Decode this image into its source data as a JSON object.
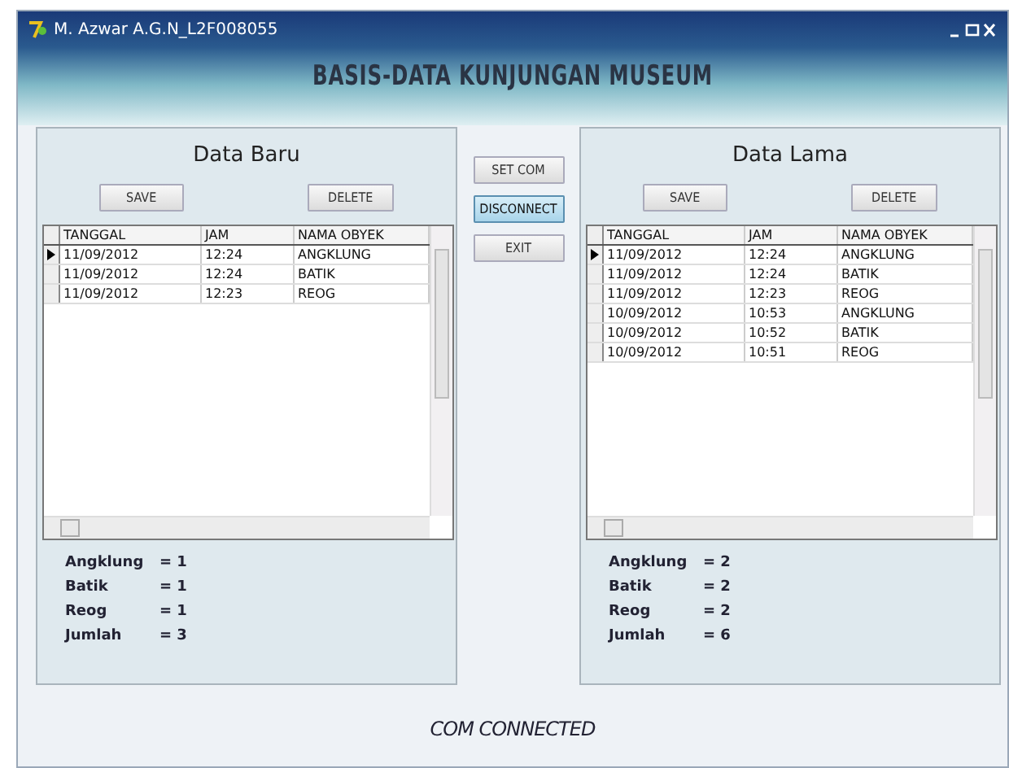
{
  "window": {
    "title": "M. Azwar A.G.N_L2F008055"
  },
  "heading": "BASIS-DATA KUNJUNGAN MUSEUM",
  "panels": [
    {
      "title": "Data Baru",
      "buttons": [
        "SAVE",
        "DELETE"
      ],
      "columns": [
        "TANGGAL",
        "JAM",
        "NAMA OBYEK"
      ],
      "rows": [
        {
          "cells": [
            "11/09/2012",
            "12:24",
            "ANGKLUNG"
          ],
          "selected": true
        },
        {
          "cells": [
            "11/09/2012",
            "12:24",
            "BATIK"
          ],
          "selected": false
        },
        {
          "cells": [
            "11/09/2012",
            "12:23",
            "REOG"
          ],
          "selected": false
        }
      ],
      "stats": [
        {
          "label": "Angklung",
          "value": "= 1"
        },
        {
          "label": "Batik",
          "value": "= 1"
        },
        {
          "label": "Reog",
          "value": "= 1"
        },
        {
          "label": "Jumlah",
          "value": "= 3"
        }
      ]
    },
    {
      "title": "Data Lama",
      "buttons": [
        "SAVE",
        "DELETE"
      ],
      "columns": [
        "TANGGAL",
        "JAM",
        "NAMA OBYEK"
      ],
      "rows": [
        {
          "cells": [
            "11/09/2012",
            "12:24",
            "ANGKLUNG"
          ],
          "selected": true
        },
        {
          "cells": [
            "11/09/2012",
            "12:24",
            "BATIK"
          ],
          "selected": false
        },
        {
          "cells": [
            "11/09/2012",
            "12:23",
            "REOG"
          ],
          "selected": false
        },
        {
          "cells": [
            "10/09/2012",
            "10:53",
            "ANGKLUNG"
          ],
          "selected": false
        },
        {
          "cells": [
            "10/09/2012",
            "10:52",
            "BATIK"
          ],
          "selected": false
        },
        {
          "cells": [
            "10/09/2012",
            "10:51",
            "REOG"
          ],
          "selected": false
        }
      ],
      "stats": [
        {
          "label": "Angklung",
          "value": "= 2"
        },
        {
          "label": "Batik",
          "value": "= 2"
        },
        {
          "label": "Reog",
          "value": "= 2"
        },
        {
          "label": "Jumlah",
          "value": "= 6"
        }
      ]
    }
  ],
  "center_buttons": [
    {
      "label": "SET COM",
      "selected": false
    },
    {
      "label": "DISCONNECT",
      "selected": true
    },
    {
      "label": "EXIT",
      "selected": false
    }
  ],
  "status": "COM CONNECTED"
}
